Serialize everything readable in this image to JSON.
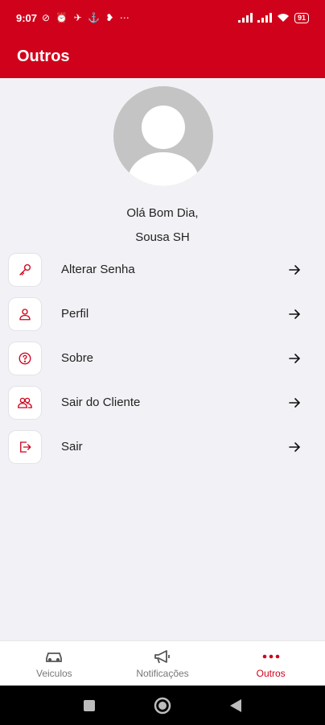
{
  "status_bar": {
    "time": "9:07",
    "battery": "91",
    "left_icons": "⊘ ⏰ ✈ ⚓ ❥ ⋯"
  },
  "app_bar": {
    "title": "Outros"
  },
  "profile": {
    "greeting_line1": "Olá Bom Dia,",
    "greeting_line2": "Sousa SH"
  },
  "menu": {
    "items": [
      {
        "label": "Alterar Senha",
        "icon": "key-icon"
      },
      {
        "label": "Perfil",
        "icon": "user-icon"
      },
      {
        "label": "Sobre",
        "icon": "help-circle-icon"
      },
      {
        "label": "Sair do Cliente",
        "icon": "users-icon"
      },
      {
        "label": "Sair",
        "icon": "logout-icon"
      }
    ]
  },
  "bottom_nav": {
    "items": [
      {
        "label": "Veiculos",
        "icon": "car-icon",
        "active": false
      },
      {
        "label": "Notificações",
        "icon": "megaphone-icon",
        "active": false
      },
      {
        "label": "Outros",
        "icon": "more-dots-icon",
        "active": true
      }
    ]
  },
  "colors": {
    "accent": "#d0021b",
    "background": "#f2f2f6",
    "text": "#222222",
    "inactive": "#777777"
  }
}
